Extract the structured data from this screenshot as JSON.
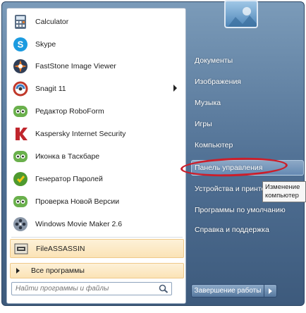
{
  "programs": [
    {
      "label": "Calculator",
      "icon": "calculator-icon"
    },
    {
      "label": "Skype",
      "icon": "skype-icon"
    },
    {
      "label": "FastStone Image Viewer",
      "icon": "faststone-icon"
    },
    {
      "label": "Snagit 11",
      "icon": "snagit-icon",
      "has_submenu": true
    },
    {
      "label": "Редактор RoboForm",
      "icon": "roboform-icon"
    },
    {
      "label": "Kaspersky Internet Security",
      "icon": "kaspersky-icon"
    },
    {
      "label": "Иконка в Таскбаре",
      "icon": "roboform-icon"
    },
    {
      "label": "Генератор Паролей",
      "icon": "password-generator-icon"
    },
    {
      "label": "Проверка Новой Версии",
      "icon": "roboform-icon"
    },
    {
      "label": "Windows Movie Maker 2.6",
      "icon": "movie-maker-icon"
    },
    {
      "label": "FileASSASSIN",
      "icon": "fileassassin-icon"
    }
  ],
  "all_programs_label": "Все программы",
  "search": {
    "placeholder": "Найти программы и файлы"
  },
  "right_links": {
    "documents": "Документы",
    "pictures": "Изображения",
    "music": "Музыка",
    "games": "Игры",
    "computer": "Компьютер",
    "control_panel": "Панель управления",
    "devices": "Устройства и принтеры",
    "default_programs": "Программы по умолчанию",
    "help": "Справка и поддержка"
  },
  "tooltip": {
    "line1": "Изменение",
    "line2": "компьютер"
  },
  "shutdown_label": "Завершение работы",
  "colors": {
    "accent_oval": "#cc1e2a",
    "menu_frame": "#4f6f93",
    "highlight_bar": "#fbe3b6"
  }
}
